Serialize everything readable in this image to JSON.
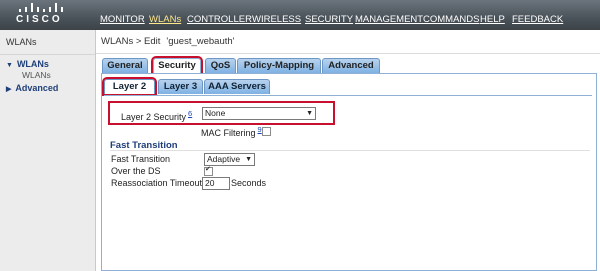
{
  "brand": {
    "logo_text": "CISCO"
  },
  "nav": {
    "items": [
      "MONITOR",
      "WLANs",
      "CONTROLLER",
      "WIRELESS",
      "SECURITY",
      "MANAGEMENT",
      "COMMANDS",
      "HELP",
      "FEEDBACK"
    ],
    "active": "WLANs"
  },
  "sidebar": {
    "title": "WLANs",
    "items": [
      {
        "label": "WLANs",
        "sub": "WLANs",
        "expanded": true
      },
      {
        "label": "Advanced",
        "expanded": false
      }
    ]
  },
  "page": {
    "breadcrumb": "WLANs > Edit",
    "wlan_name": "'guest_webauth'"
  },
  "tabs": [
    "General",
    "Security",
    "QoS",
    "Policy-Mapping",
    "Advanced"
  ],
  "active_tab": "Security",
  "subtabs": [
    "Layer 2",
    "Layer 3",
    "AAA Servers"
  ],
  "active_subtab": "Layer 2",
  "layer2": {
    "security_label": "Layer 2 Security",
    "security_footnote": "6",
    "security_value": "None",
    "mac_filtering_label": "MAC Filtering",
    "mac_filtering_footnote": "9",
    "mac_filtering_checked": false
  },
  "fast_transition": {
    "title": "Fast Transition",
    "ft_label": "Fast Transition",
    "ft_value": "Adaptive",
    "ds_label": "Over the DS",
    "ds_checked": true,
    "timeout_label": "Reassociation Timeout",
    "timeout_value": "20",
    "timeout_unit": "Seconds"
  },
  "colors": {
    "highlight": "#c8102e",
    "link": "#1f3f7a",
    "tab": "#7fb1e3",
    "header": "#4b535a"
  }
}
